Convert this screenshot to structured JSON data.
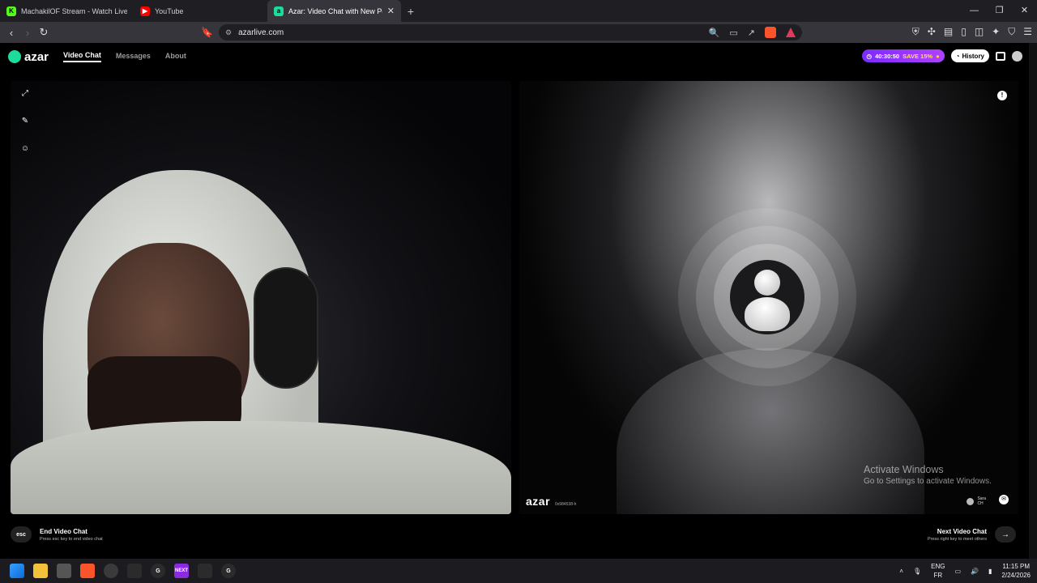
{
  "browser": {
    "tabs": [
      {
        "title": "MachakilOF Stream - Watch Live on I",
        "fav_color": "#53fc18",
        "fav_char": "K"
      },
      {
        "title": "YouTube",
        "fav_color": "#ff0000",
        "fav_char": "▶"
      },
      {
        "title": "Azar: Video Chat with New Pe",
        "fav_color": "#1ddb9b",
        "fav_char": "a",
        "active": true
      }
    ],
    "url": "azarlive.com"
  },
  "app": {
    "logo": "azar",
    "nav": [
      "Video Chat",
      "Messages",
      "About"
    ],
    "promo_timer": "40:30:50",
    "promo_save": "SAVE 15%",
    "history_label": "History"
  },
  "peer_panel": {
    "watermark": "azar",
    "watermark_id": "0x984538-h",
    "peer_name": "Sara",
    "peer_country": "CH"
  },
  "footer": {
    "end_key": "esc",
    "end_title": "End Video Chat",
    "end_sub": "Press esc key to end video chat",
    "next_title": "Next Video Chat",
    "next_sub": "Press right key to meet others",
    "next_key": "→"
  },
  "overlay": {
    "activate_title": "Activate Windows",
    "activate_sub": "Go to Settings to activate Windows."
  },
  "taskbar": {
    "lang_1": "ENG",
    "lang_2": "FR",
    "time": "11:15 PM",
    "date": "2/24/2026"
  },
  "icons": {
    "next_app_label": "NEXT"
  }
}
